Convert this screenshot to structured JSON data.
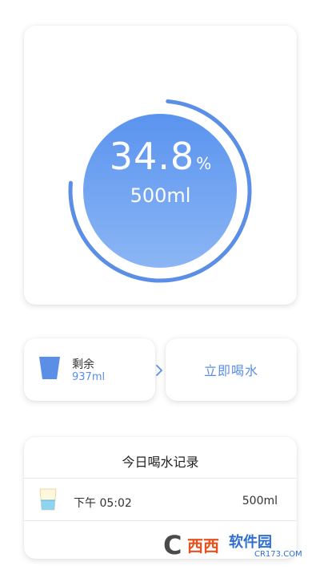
{
  "colors": {
    "accent": "#5b8ee6",
    "circle_top": "#5a93ef",
    "circle_bottom": "#8bb6f4",
    "ring": "#5b8ee6"
  },
  "progress": {
    "percent_value": "34.8",
    "percent_sign": "%",
    "fraction": 0.348,
    "volume": "500ml"
  },
  "remaining": {
    "icon": "water-cup-icon",
    "label": "剩余",
    "value": "937ml"
  },
  "drink_now": {
    "label": "立即喝水"
  },
  "records": {
    "title": "今日喝水记录",
    "items": [
      {
        "icon": "water-glass-icon",
        "time": "下午 05:02",
        "amount": "500ml"
      }
    ]
  },
  "watermark": {
    "brand_c": "C",
    "brand_xi": "西西",
    "brand_soft": "软件园",
    "site": "CR173.COM"
  }
}
